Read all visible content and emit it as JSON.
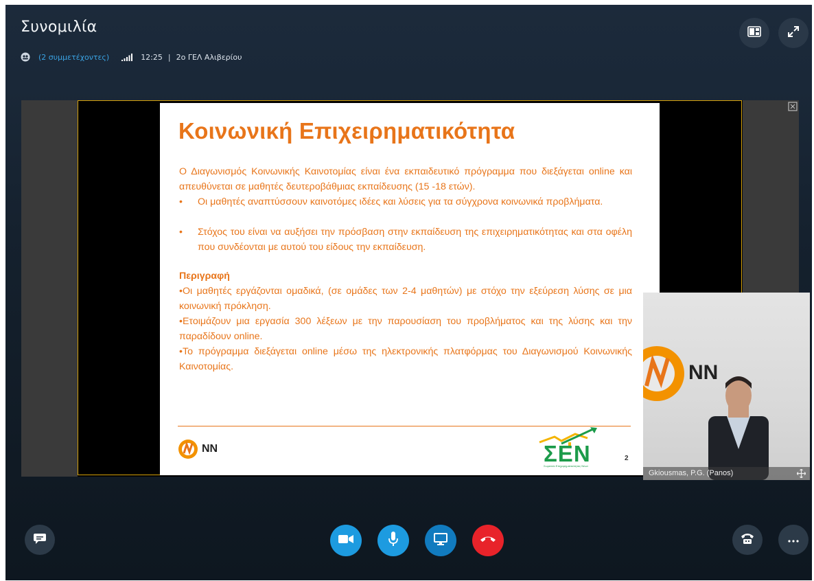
{
  "window": {
    "title": "Συνομιλία"
  },
  "infobar": {
    "participants": "(2 συμμετέχοντες)",
    "time": "12:25",
    "separator": "|",
    "group": "2ο ΓΕΛ Αλιβερίου"
  },
  "top_buttons": [
    {
      "icon": "layout-icon"
    },
    {
      "icon": "fullscreen-icon"
    }
  ],
  "slide": {
    "title": "Κοινωνική Επιχειρηματικότητα",
    "intro": "Ο Διαγωνισμός Κοινωνικής Καινοτομίας είναι ένα εκπαιδευτικό πρόγραμμα που διεξάγεται online και απευθύνεται σε μαθητές δευτεροβάθμιας εκπαίδευσης (15 -18 ετών).",
    "bullets": [
      "Οι μαθητές αναπτύσσουν καινοτόμες ιδέες και λύσεις για τα σύγχρονα κοινωνικά προβλήματα.",
      "Στόχος του είναι να αυξήσει την πρόσβαση στην εκπαίδευση της επιχειρηματικότητας και στα οφέλη που συνδέονται με αυτού του είδους την εκπαίδευση."
    ],
    "description_heading": "Περιγραφή",
    "description": [
      "•Οι μαθητές εργάζονται ομαδικά, (σε ομάδες των 2-4 μαθητών) με στόχο την εξεύρεση λύσης σε μια κοινωνική πρόκληση.",
      "•Ετοιμάζουν μια εργασία 300 λέξεων με την παρουσίαση του προβλήματος και της λύσης και την παραδίδουν online.",
      "•Το πρόγραμμα διεξάγεται online μέσω της ηλεκτρονικής πλατφόρμας του Διαγωνισμού Κοινωνικής Καινοτομίας."
    ],
    "bullet_mark": "•",
    "logo_text": "NN",
    "sen_logo": "ΣΕΝ",
    "sen_sub": "Σωματείο Επιχειρηματικότητας Νέων",
    "page_number": "2"
  },
  "participant": {
    "name": "Gkiousmas, P.G. (Panos)",
    "wall_logo": "NN"
  },
  "controls": [
    {
      "icon": "chat-icon"
    },
    {
      "icon": "video-camera-icon"
    },
    {
      "icon": "microphone-icon"
    },
    {
      "icon": "screen-share-icon"
    },
    {
      "icon": "hang-up-icon"
    },
    {
      "icon": "call-controls-icon"
    },
    {
      "icon": "more-options-icon"
    }
  ],
  "colors": {
    "accent_orange": "#e8751a",
    "skype_blue": "#1d9be0",
    "hangup_red": "#e8232a",
    "share_dark": "#117bbf"
  }
}
